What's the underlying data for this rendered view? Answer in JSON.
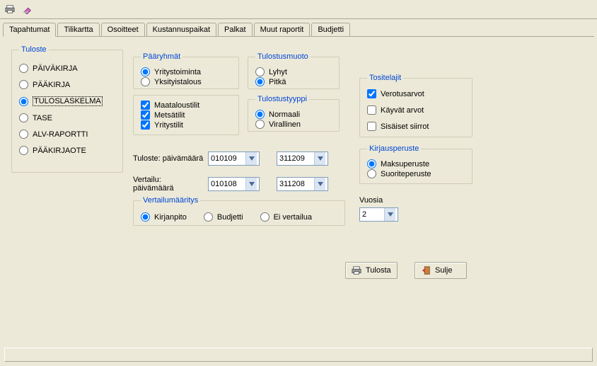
{
  "tabs": [
    "Tapahtumat",
    "Tilikartta",
    "Osoitteet",
    "Kustannuspaikat",
    "Palkat",
    "Muut raportit",
    "Budjetti"
  ],
  "tabs_selected_index": 0,
  "tuloste": {
    "legend": "Tuloste",
    "options": [
      "PÄIVÄKIRJA",
      "PÄÄKIRJA",
      "TULOSLASKELMA",
      "TASE",
      "ALV-RAPORTTI",
      "PÄÄKIRJAOTE"
    ],
    "selected_index": 2
  },
  "paaryhmat": {
    "legend": "Pääryhmät",
    "options": [
      "Yritystoiminta",
      "Yksityistalous"
    ],
    "selected_index": 0
  },
  "tilit": {
    "options": [
      {
        "label": "Maataloustilit",
        "checked": true
      },
      {
        "label": "Metsätilit",
        "checked": true
      },
      {
        "label": "Yritystilit",
        "checked": true
      }
    ]
  },
  "tulostusmuoto": {
    "legend": "Tulostusmuoto",
    "options": [
      "Lyhyt",
      "Pitkä"
    ],
    "selected_index": 1
  },
  "tulostustyyppi": {
    "legend": "Tulostustyyppi",
    "options": [
      "Normaali",
      "Virallinen"
    ],
    "selected_index": 0
  },
  "tositelajit": {
    "legend": "Tositelajit",
    "options": [
      {
        "label": "Verotusarvot",
        "checked": true
      },
      {
        "label": "Käyvät arvot",
        "checked": false
      },
      {
        "label": "Sisäiset siirrot",
        "checked": false
      }
    ]
  },
  "kirjausperuste": {
    "legend": "Kirjausperuste",
    "options": [
      "Maksuperuste",
      "Suoriteperuste"
    ],
    "selected_index": 0
  },
  "dates": {
    "tuloste_label": "Tuloste: päivämäärä",
    "tuloste_from": "010109",
    "tuloste_to": "311209",
    "vertailu_label": "Vertailu: päivämäärä",
    "vertailu_from": "010108",
    "vertailu_to": "311208"
  },
  "vertailumaaritys": {
    "legend": "Vertailumääritys",
    "options": [
      "Kirjanpito",
      "Budjetti",
      "Ei vertailua"
    ],
    "selected_index": 0
  },
  "vuosia": {
    "label": "Vuosia",
    "value": "2"
  },
  "buttons": {
    "tulosta": "Tulosta",
    "sulje": "Sulje"
  }
}
